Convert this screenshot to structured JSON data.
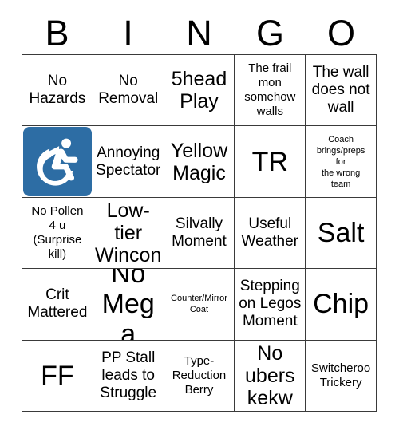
{
  "card": {
    "header_letters": [
      "B",
      "I",
      "N",
      "G",
      "O"
    ],
    "marker_color": "#2d6da4",
    "grid_line_color": "#3a3a3a",
    "background_color": "#ffffff",
    "rows": [
      [
        {
          "text": "No\nHazards",
          "size": "md",
          "marked": false
        },
        {
          "text": "No\nRemoval",
          "size": "md",
          "marked": false
        },
        {
          "text": "5head\nPlay",
          "size": "lg",
          "marked": false
        },
        {
          "text": "The frail\nmon\nsomehow\nwalls",
          "size": "sm",
          "marked": false
        },
        {
          "text": "The wall\ndoes not\nwall",
          "size": "md",
          "marked": false
        }
      ],
      [
        {
          "text": "",
          "size": "md",
          "marked": true,
          "marker_icon": "accessible-wheelchair-icon"
        },
        {
          "text": "Annoying\nSpectator",
          "size": "md",
          "marked": false
        },
        {
          "text": "Yellow\nMagic",
          "size": "lg",
          "marked": false
        },
        {
          "text": "TR",
          "size": "xl",
          "marked": false
        },
        {
          "text": "Coach\nbrings/preps\nfor\nthe wrong\nteam",
          "size": "xs",
          "marked": false
        }
      ],
      [
        {
          "text": "No Pollen\n4 u\n(Surprise\nkill)",
          "size": "sm",
          "marked": false
        },
        {
          "text": "Low-\ntier\nWincon",
          "size": "lg",
          "marked": false
        },
        {
          "text": "Silvally\nMoment",
          "size": "md",
          "marked": false
        },
        {
          "text": "Useful\nWeather",
          "size": "md",
          "marked": false
        },
        {
          "text": "Salt",
          "size": "xl",
          "marked": false
        }
      ],
      [
        {
          "text": "Crit\nMattered",
          "size": "md",
          "marked": false
        },
        {
          "text": "No\nMega",
          "size": "xl",
          "marked": false
        },
        {
          "text": "Counter/Mirror\nCoat",
          "size": "xs",
          "marked": false
        },
        {
          "text": "Stepping\non Legos\nMoment",
          "size": "md",
          "marked": false
        },
        {
          "text": "Chip",
          "size": "xl",
          "marked": false
        }
      ],
      [
        {
          "text": "FF",
          "size": "xl",
          "marked": false
        },
        {
          "text": "PP Stall\nleads to\nStruggle",
          "size": "md",
          "marked": false
        },
        {
          "text": "Type-\nReduction\nBerry",
          "size": "sm",
          "marked": false
        },
        {
          "text": "No\nubers\nkekw",
          "size": "lg",
          "marked": false
        },
        {
          "text": "Switcheroo\nTrickery",
          "size": "sm",
          "marked": false
        }
      ]
    ]
  }
}
